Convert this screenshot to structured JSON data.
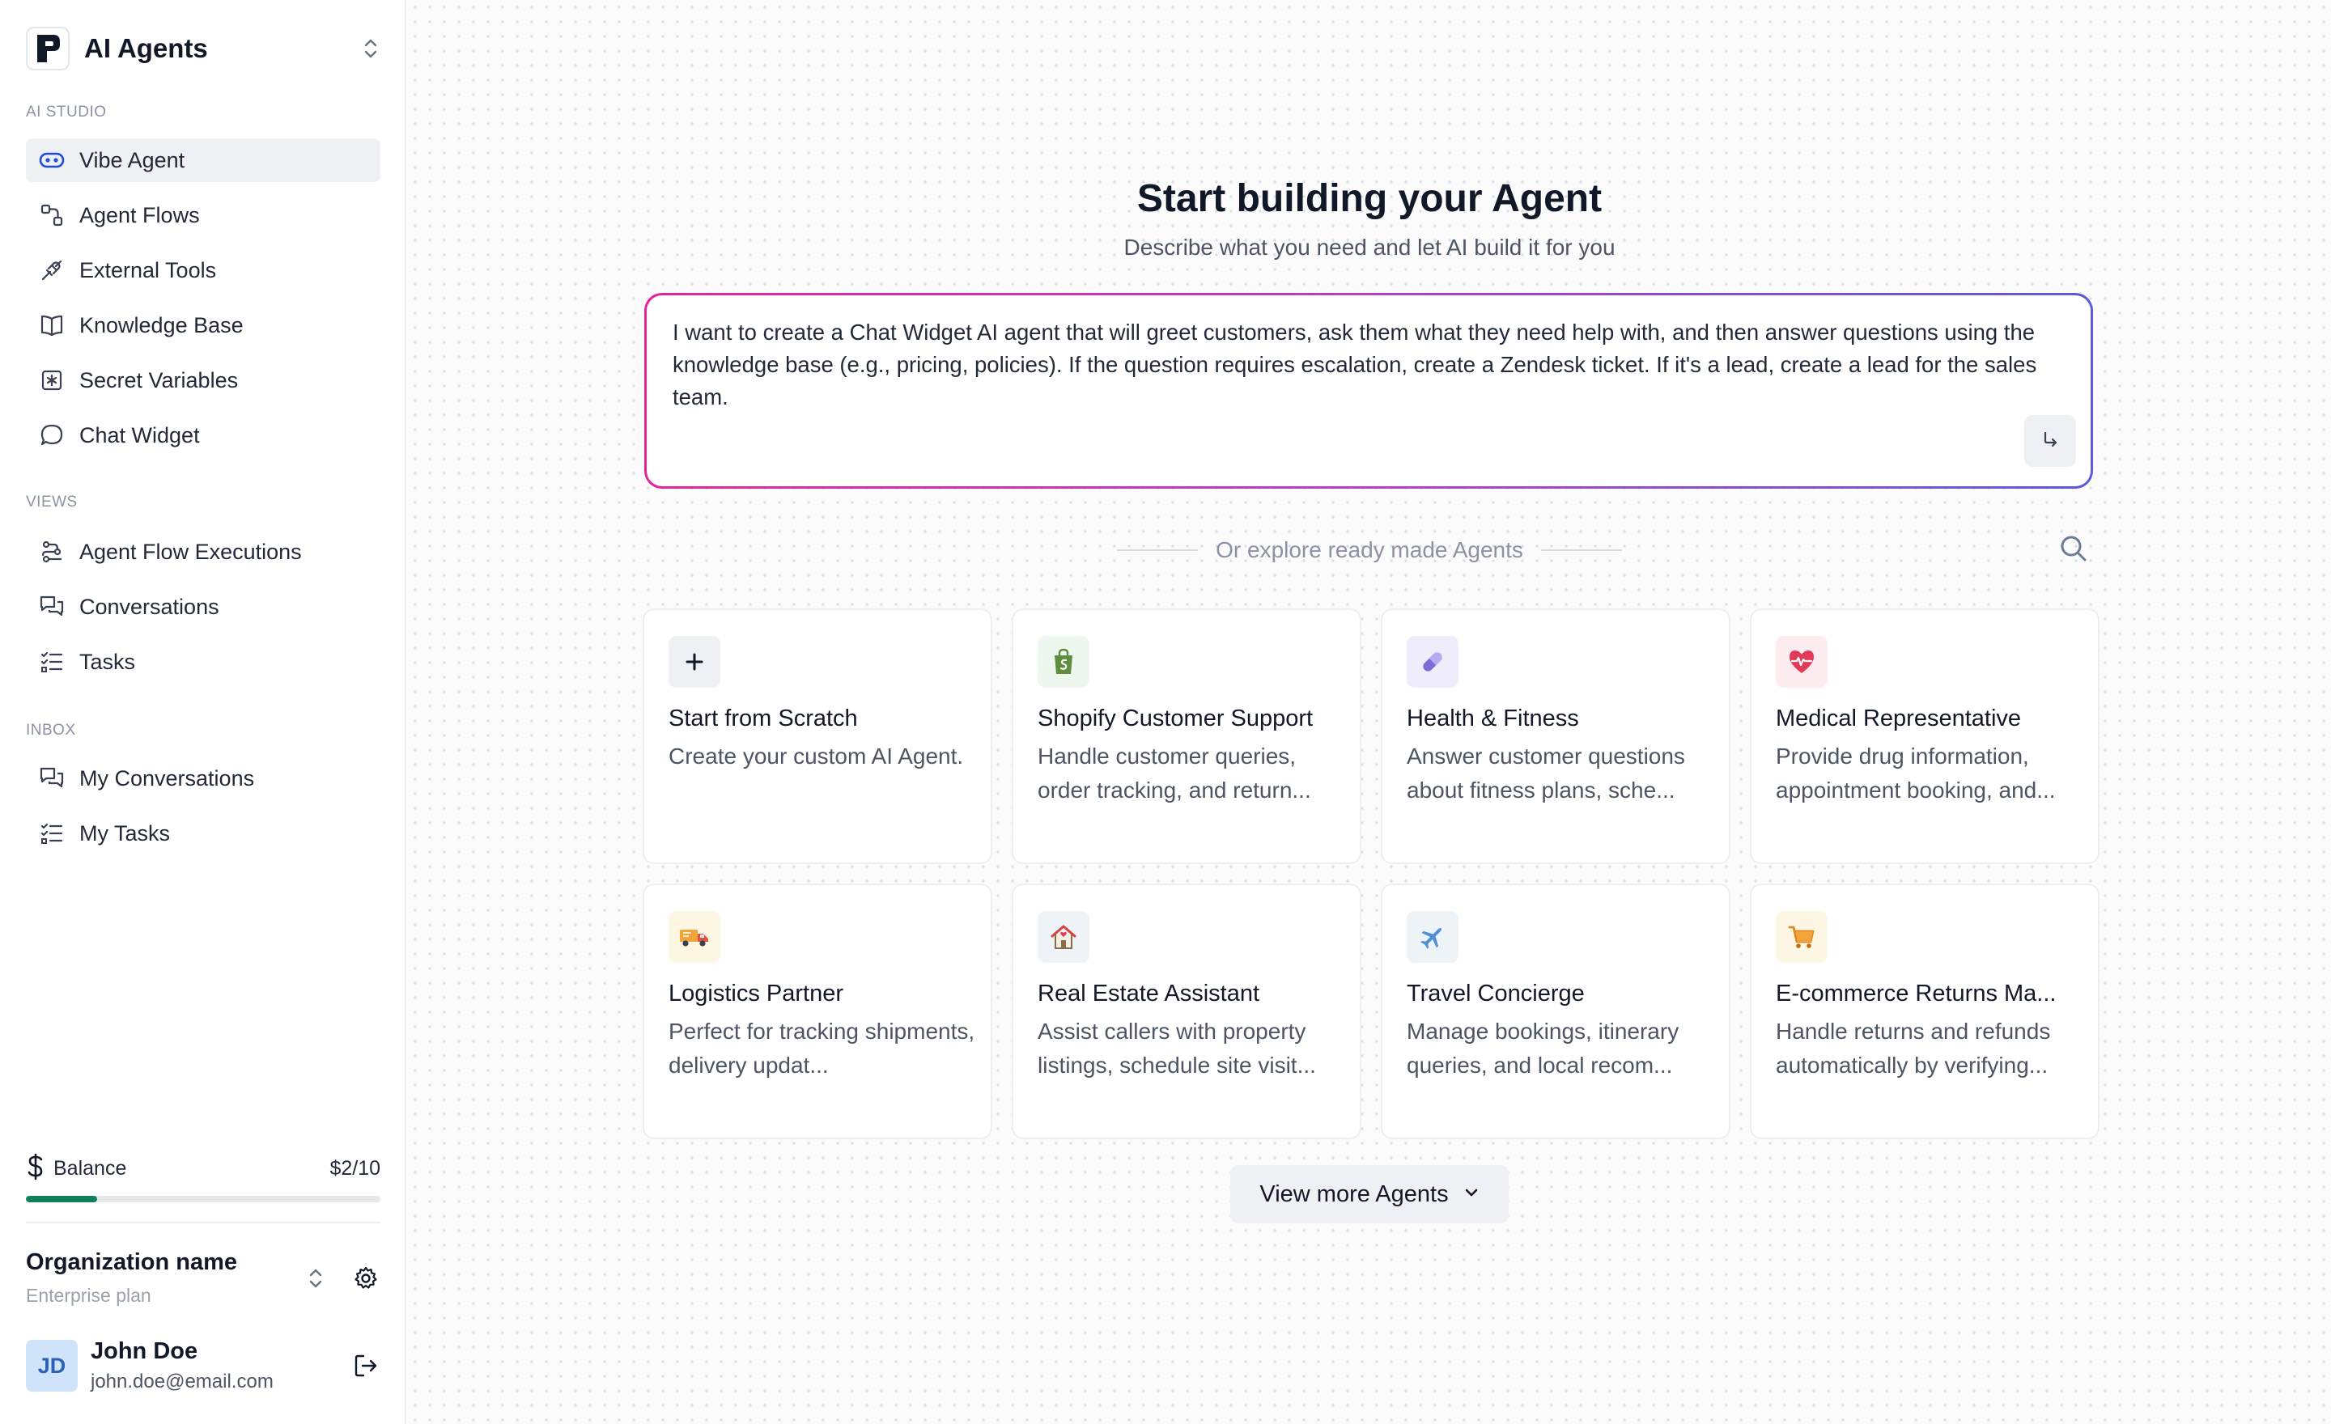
{
  "app": {
    "title": "AI Agents"
  },
  "sidebar": {
    "sections": [
      {
        "label": "AI STUDIO",
        "items": [
          {
            "label": "Vibe Agent",
            "icon": "vibe-agent-icon",
            "active": true
          },
          {
            "label": "Agent Flows",
            "icon": "flows-icon"
          },
          {
            "label": "External Tools",
            "icon": "plug-icon"
          },
          {
            "label": "Knowledge Base",
            "icon": "book-icon"
          },
          {
            "label": "Secret Variables",
            "icon": "secret-icon"
          },
          {
            "label": "Chat Widget",
            "icon": "chat-icon"
          }
        ]
      },
      {
        "label": "VIEWS",
        "items": [
          {
            "label": "Agent Flow Executions",
            "icon": "executions-icon"
          },
          {
            "label": "Conversations",
            "icon": "conversations-icon"
          },
          {
            "label": "Tasks",
            "icon": "tasks-icon"
          }
        ]
      },
      {
        "label": "INBOX",
        "items": [
          {
            "label": "My Conversations",
            "icon": "conversations-icon"
          },
          {
            "label": "My Tasks",
            "icon": "tasks-icon"
          }
        ]
      }
    ],
    "balance": {
      "label": "Balance",
      "value": "$2/10",
      "fraction": 0.2,
      "color": "#12805c"
    },
    "organization": {
      "name": "Organization name",
      "plan": "Enterprise plan"
    },
    "user": {
      "initials": "JD",
      "name": "John Doe",
      "email": "john.doe@email.com"
    }
  },
  "main": {
    "title": "Start building your Agent",
    "subtitle": "Describe what you need and let AI build it for you",
    "prompt": "I want to create a Chat Widget AI agent that will greet customers, ask them what they need help with, and then answer questions using the knowledge base (e.g., pricing, policies). If the question requires escalation, create a Zendesk ticket. If it's a lead, create a lead for the sales team.",
    "explore_label": "Or explore ready made Agents",
    "cards": [
      {
        "title": "Start from Scratch",
        "description": "Create your custom AI Agent.",
        "icon": "plus-icon",
        "icon_bg": "#eef0f4"
      },
      {
        "title": "Shopify Customer Support",
        "description": "Handle customer queries, order tracking, and return...",
        "icon": "shopify-bag-icon",
        "icon_bg": "#eef7ee"
      },
      {
        "title": "Health & Fitness",
        "description": "Answer customer questions about fitness plans, sche...",
        "icon": "pill-icon",
        "icon_bg": "#efedfb"
      },
      {
        "title": "Medical Representative",
        "description": "Provide drug information, appointment booking, and...",
        "icon": "heart-pulse-icon",
        "icon_bg": "#fdecef"
      },
      {
        "title": "Logistics Partner",
        "description": "Perfect for tracking shipments, delivery updat...",
        "icon": "truck-icon",
        "icon_bg": "#fdf6e3"
      },
      {
        "title": "Real Estate Assistant",
        "description": "Assist callers with property listings, schedule site visit...",
        "icon": "house-icon",
        "icon_bg": "#eef3f8"
      },
      {
        "title": "Travel Concierge",
        "description": "Manage bookings, itinerary queries, and local recom...",
        "icon": "airplane-icon",
        "icon_bg": "#eef3f8"
      },
      {
        "title": "E-commerce Returns Ma...",
        "description": "Handle returns and refunds automatically by verifying...",
        "icon": "cart-icon",
        "icon_bg": "#fdf6e3"
      }
    ],
    "view_more_label": "View more Agents"
  }
}
